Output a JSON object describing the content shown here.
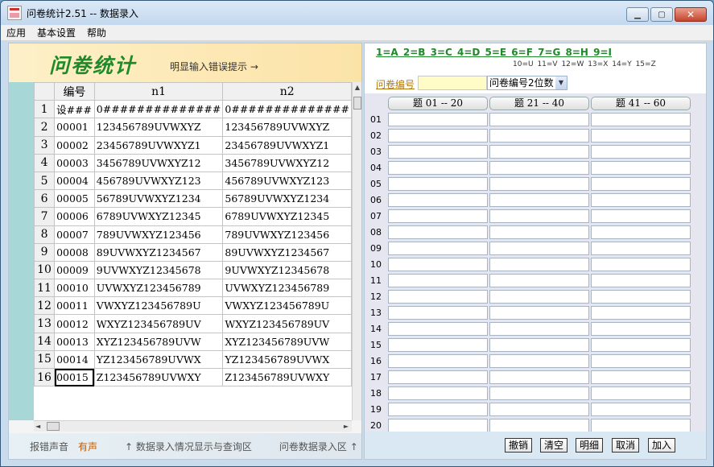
{
  "window": {
    "title": "问卷统计2.51 -- 数据录入"
  },
  "menu": [
    "应用",
    "基本设置",
    "帮助"
  ],
  "banner": {
    "title": "问卷统计",
    "hint": "明显输入错误提示 →"
  },
  "grid": {
    "headers": [
      "",
      "编号",
      "n1",
      "n2"
    ],
    "rows": [
      [
        "1",
        "设###",
        "0##############",
        "0##############"
      ],
      [
        "2",
        "00001",
        "123456789UVWXYZ",
        "123456789UVWXYZ"
      ],
      [
        "3",
        "00002",
        "23456789UVWXYZ1",
        "23456789UVWXYZ1"
      ],
      [
        "4",
        "00003",
        "3456789UVWXYZ12",
        "3456789UVWXYZ12"
      ],
      [
        "5",
        "00004",
        "456789UVWXYZ123",
        "456789UVWXYZ123"
      ],
      [
        "6",
        "00005",
        "56789UVWXYZ1234",
        "56789UVWXYZ1234"
      ],
      [
        "7",
        "00006",
        "6789UVWXYZ12345",
        "6789UVWXYZ12345"
      ],
      [
        "8",
        "00007",
        "789UVWXYZ123456",
        "789UVWXYZ123456"
      ],
      [
        "9",
        "00008",
        "89UVWXYZ1234567",
        "89UVWXYZ1234567"
      ],
      [
        "10",
        "00009",
        "9UVWXYZ12345678",
        "9UVWXYZ12345678"
      ],
      [
        "11",
        "00010",
        "UVWXYZ123456789",
        "UVWXYZ123456789"
      ],
      [
        "12",
        "00011",
        "VWXYZ123456789U",
        "VWXYZ123456789U"
      ],
      [
        "13",
        "00012",
        "WXYZ123456789UV",
        "WXYZ123456789UV"
      ],
      [
        "14",
        "00013",
        "XYZ123456789UVW",
        "XYZ123456789UVW"
      ],
      [
        "15",
        "00014",
        "YZ123456789UVWX",
        "YZ123456789UVWX"
      ],
      [
        "16",
        "00015",
        "Z123456789UVWXY",
        "Z123456789UVWXY"
      ]
    ]
  },
  "status": {
    "sound_label": "报错声音",
    "sound_value": "有声",
    "left_hint": "↑ 数据录入情况显示与查询区",
    "right_hint": "问卷数据录入区 ↑"
  },
  "key_map": {
    "top": "1=A  2=B  3=C  4=D  5=E  6=F  7=G  8=H  9=I",
    "bottom": "10=U  11=V  12=W  13=X  14=Y  15=Z"
  },
  "qno": {
    "label": "问卷编号",
    "value": "",
    "select": "问卷编号2位数"
  },
  "columns": [
    "题 01 -- 20",
    "题 21 -- 40",
    "题 41 -- 60"
  ],
  "row_labels": [
    "01",
    "02",
    "03",
    "04",
    "05",
    "06",
    "07",
    "08",
    "09",
    "10",
    "11",
    "12",
    "13",
    "14",
    "15",
    "16",
    "17",
    "18",
    "19",
    "20"
  ],
  "actions": [
    "撤销",
    "清空",
    "明细",
    "取消",
    "加入"
  ]
}
